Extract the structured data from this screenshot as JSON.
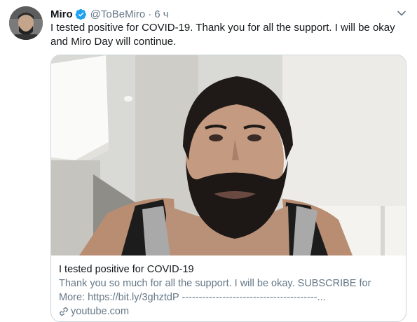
{
  "tweet": {
    "author_name": "Miro",
    "handle": "@ToBeMiro",
    "separator": "·",
    "time": "6 ч",
    "text": "I tested positive for COVID-19. Thank you for all the support. I will be okay and Miro Day will continue."
  },
  "card": {
    "title": "I tested positive for COVID-19",
    "description": "Thank you so much for all the support. I will be okay. SUBSCRIBE for More: https://bit.ly/3ghztdP ----------------------------------------...",
    "domain": "youtube.com"
  },
  "icons": {
    "verified": "verified-badge-icon",
    "caret": "chevron-down-icon",
    "link": "link-icon"
  },
  "colors": {
    "accent": "#1da1f2",
    "text": "#14171a",
    "secondary": "#657786",
    "border": "#ccd6dd"
  }
}
